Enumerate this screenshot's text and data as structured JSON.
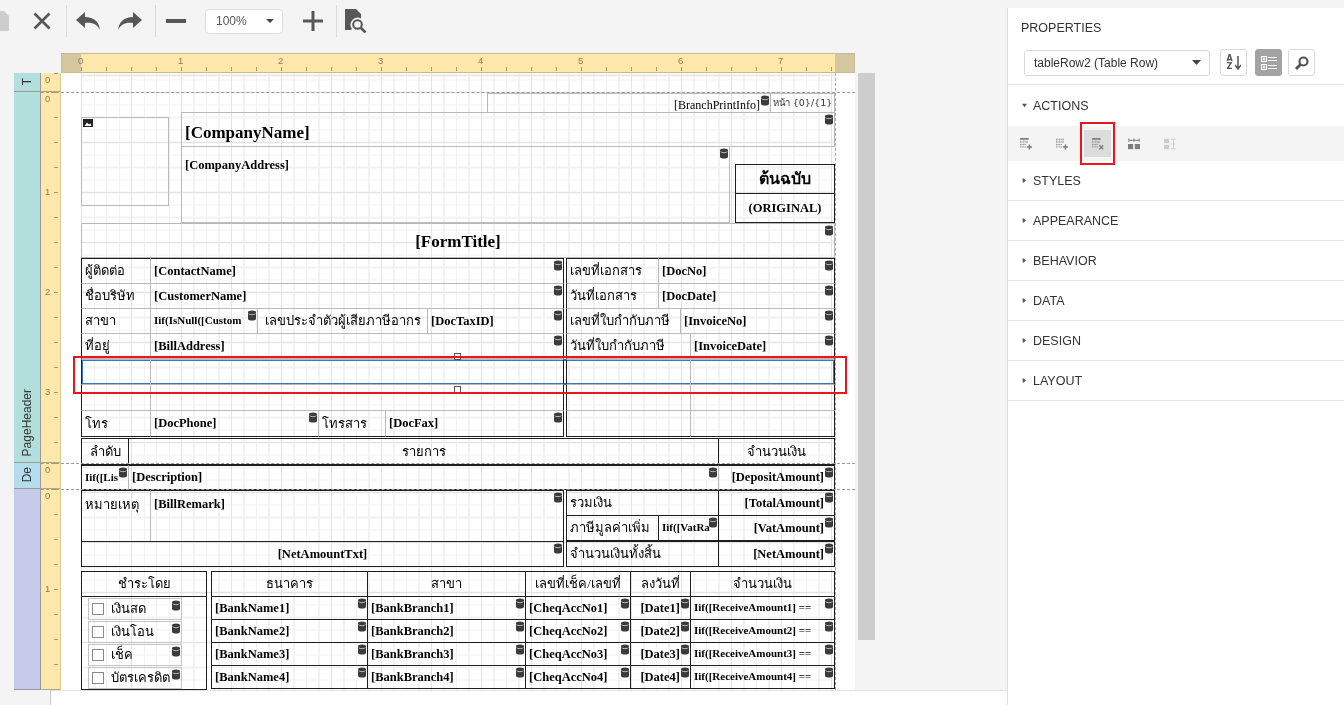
{
  "toolbar": {
    "buttons": [
      {
        "disabled": true
      },
      {
        "disabled": false
      },
      {
        "disabled": false
      },
      {
        "disabled": false
      },
      {
        "disabled": false
      },
      {
        "disabled": false
      },
      {
        "disabled": false
      }
    ],
    "zoom": "100%"
  },
  "design_surface": {
    "ruler": [
      "0",
      "1",
      "2",
      "3",
      "4",
      "5",
      "6",
      "7"
    ],
    "bands": [
      {
        "label": "T",
        "color": "#b2dfdb",
        "ruler": [
          "0"
        ]
      },
      {
        "label": "PageHeader",
        "color": "#b2dfdb",
        "ruler": [
          "0",
          "1",
          "2",
          "3"
        ]
      },
      {
        "label": "De",
        "color": "#b3dcec",
        "ruler": [
          "0"
        ]
      },
      {
        "color": "#c5cae9",
        "ruler": [
          "0",
          "1"
        ]
      }
    ],
    "header": [
      {
        "text": "[BranchPrintInfo]",
        "bound": true
      },
      {
        "text": "หน้า {0}/{1}",
        "bound": false
      },
      {
        "text": "[CompanyName]",
        "bound": true
      },
      {
        "text": "[CompanyAddress]",
        "bound": true
      },
      {
        "text": "ต้นฉบับ",
        "bound": false
      },
      {
        "text": "(ORIGINAL)",
        "bound": false
      },
      {
        "text": "[FormTitle]",
        "bound": true
      }
    ],
    "info_rows": [
      {
        "selected": false,
        "highlighted": false,
        "cells": [
          {
            "text": "ผู้ติดต่อ",
            "kind": "label",
            "bound": false
          },
          {
            "text": "[ContactName]",
            "kind": "field",
            "bound": true
          },
          {
            "text": "เลขที่เอกสาร",
            "kind": "label",
            "bound": false
          },
          {
            "text": "[DocNo]",
            "kind": "field",
            "bound": true
          }
        ]
      },
      {
        "selected": false,
        "highlighted": false,
        "cells": [
          {
            "text": "ชื่อบริษัท",
            "kind": "label",
            "bound": false
          },
          {
            "text": "[CustomerName]",
            "kind": "field",
            "bound": true
          },
          {
            "text": "วันที่เอกสาร",
            "kind": "label",
            "bound": false
          },
          {
            "text": "[DocDate]",
            "kind": "field",
            "bound": true
          }
        ]
      },
      {
        "selected": false,
        "highlighted": false,
        "cells": [
          {
            "text": "สาขา",
            "kind": "label",
            "bound": false
          },
          {
            "text": "Iif(IsNull([Custom",
            "kind": "field",
            "bound": true
          },
          {
            "text": "เลขประจำตัวผู้เสียภาษีอากร",
            "kind": "label",
            "bound": false
          },
          {
            "text": "[DocTaxID]",
            "kind": "field",
            "bound": true
          },
          {
            "text": "เลขที่ใบกำกับภาษี",
            "kind": "label",
            "bound": false
          },
          {
            "text": "[InvoiceNo]",
            "kind": "field",
            "bound": true
          }
        ]
      },
      {
        "selected": false,
        "highlighted": false,
        "cells": [
          {
            "text": "ที่อยู่",
            "kind": "label",
            "bound": false
          },
          {
            "text": "[BillAddress]",
            "kind": "field",
            "bound": true
          },
          {
            "text": "วันที่ใบกำกับภาษี",
            "kind": "label",
            "bound": false
          },
          {
            "text": "[InvoiceDate]",
            "kind": "field",
            "bound": true
          }
        ]
      },
      {
        "selected": true,
        "highlighted": true
      },
      {
        "selected": false,
        "highlighted": false
      },
      {
        "selected": false,
        "highlighted": false,
        "cells": [
          {
            "text": "โทร",
            "kind": "label",
            "bound": false
          },
          {
            "text": "[DocPhone]",
            "kind": "field",
            "bound": true
          },
          {
            "text": "โทรสาร",
            "kind": "label",
            "bound": false
          },
          {
            "text": "[DocFax]",
            "kind": "field",
            "bound": true
          }
        ]
      }
    ],
    "items_table": {
      "header": [
        {
          "text": "ลำดับ",
          "kind": "label",
          "bound": false
        },
        {
          "text": "รายการ",
          "kind": "label",
          "bound": false
        },
        {
          "text": "จำนวนเงิน",
          "kind": "label",
          "bound": false
        }
      ],
      "detail": [
        {
          "text": "Iif([Lis",
          "kind": "field",
          "bound": true
        },
        {
          "text": "[Description]",
          "kind": "field",
          "bound": true
        },
        {
          "text": "[DepositAmount]",
          "kind": "field",
          "bound": true
        }
      ]
    },
    "totals": [
      {
        "text": "หมายเหตุ",
        "kind": "label",
        "bound": false
      },
      {
        "text": "[BillRemark]",
        "kind": "field",
        "bound": true
      },
      {
        "text": "รวมเงิน",
        "kind": "label",
        "bound": false
      },
      {
        "text": "[TotalAmount]",
        "kind": "field",
        "bound": true
      },
      {
        "text": "ภาษีมูลค่าเพิ่ม",
        "kind": "label",
        "bound": false
      },
      {
        "text": "Iif([VatRa",
        "kind": "field",
        "bound": true
      },
      {
        "text": "[VatAmount]",
        "kind": "field",
        "bound": true
      },
      {
        "text": "[NetAmountTxt]",
        "kind": "field",
        "bound": true
      },
      {
        "text": "จำนวนเงินทั้งสิ้น",
        "kind": "label",
        "bound": false
      },
      {
        "text": "[NetAmount]",
        "kind": "field",
        "bound": true
      }
    ],
    "payment": {
      "title": {
        "text": "ชำระโดย",
        "kind": "label",
        "bound": false
      },
      "methods": [
        {
          "text": "เงินสด",
          "checked": false,
          "bound": true
        },
        {
          "text": "เงินโอน",
          "checked": false,
          "bound": true
        },
        {
          "text": "เช็ค",
          "checked": false,
          "bound": true
        },
        {
          "text": "บัตรเครดิต",
          "checked": false,
          "bound": true
        }
      ],
      "columns": [
        {
          "text": "ธนาคาร",
          "kind": "label",
          "bound": false
        },
        {
          "text": "สาขา",
          "kind": "label",
          "bound": false
        },
        {
          "text": "เลขที่เช็ค/เลขที่",
          "kind": "label",
          "bound": false
        },
        {
          "text": "ลงวันที่",
          "kind": "label",
          "bound": false
        },
        {
          "text": "จำนวนเงิน",
          "kind": "label",
          "bound": false
        }
      ],
      "rows": [
        {
          "cells": [
            {
              "text": "[BankName1]",
              "kind": "field",
              "bound": true
            },
            {
              "text": "[BankBranch1]",
              "kind": "field",
              "bound": true
            },
            {
              "text": "[CheqAccNo1]",
              "kind": "field",
              "bound": true
            },
            {
              "text": "[Date1]",
              "kind": "field",
              "bound": true
            },
            {
              "text": "Iif([ReceiveAmount1] ==",
              "kind": "field",
              "bound": true
            }
          ]
        },
        {
          "cells": [
            {
              "text": "[BankName2]",
              "kind": "field",
              "bound": true
            },
            {
              "text": "[BankBranch2]",
              "kind": "field",
              "bound": true
            },
            {
              "text": "[CheqAccNo2]",
              "kind": "field",
              "bound": true
            },
            {
              "text": "[Date2]",
              "kind": "field",
              "bound": true
            },
            {
              "text": "Iif([ReceiveAmount2] ==",
              "kind": "field",
              "bound": true
            }
          ]
        },
        {
          "cells": [
            {
              "text": "[BankName3]",
              "kind": "field",
              "bound": true
            },
            {
              "text": "[BankBranch3]",
              "kind": "field",
              "bound": true
            },
            {
              "text": "[CheqAccNo3]",
              "kind": "field",
              "bound": true
            },
            {
              "text": "[Date3]",
              "kind": "field",
              "bound": true
            },
            {
              "text": "Iif([ReceiveAmount3] ==",
              "kind": "field",
              "bound": true
            }
          ]
        },
        {
          "cells": [
            {
              "text": "[BankName4]",
              "kind": "field",
              "bound": true
            },
            {
              "text": "[BankBranch4]",
              "kind": "field",
              "bound": true
            },
            {
              "text": "[CheqAccNo4]",
              "kind": "field",
              "bound": true
            },
            {
              "text": "[Date4]",
              "kind": "field",
              "bound": true
            },
            {
              "text": "Iif([ReceiveAmount4] ==",
              "kind": "field",
              "bound": true
            }
          ]
        }
      ]
    }
  },
  "properties": {
    "title": "PROPERTIES",
    "object": "tableRow2 (Table Row)",
    "sort_button": {
      "letters": [
        "A",
        "Z"
      ],
      "selected": false
    },
    "categories_button": {
      "selected": true
    },
    "sections": [
      {
        "label": "ACTIONS",
        "expanded": true,
        "actions": [
          {
            "hovered": false,
            "highlighted": false,
            "disabled": false
          },
          {
            "hovered": false,
            "highlighted": false,
            "disabled": false
          },
          {
            "hovered": true,
            "highlighted": true,
            "disabled": false
          },
          {
            "hovered": false,
            "highlighted": false,
            "disabled": false
          },
          {
            "hovered": false,
            "highlighted": false,
            "disabled": true
          }
        ]
      },
      {
        "label": "STYLES",
        "expanded": false
      },
      {
        "label": "APPEARANCE",
        "expanded": false
      },
      {
        "label": "BEHAVIOR",
        "expanded": false
      },
      {
        "label": "DATA",
        "expanded": false
      },
      {
        "label": "DESIGN",
        "expanded": false
      },
      {
        "label": "LAYOUT",
        "expanded": false
      }
    ]
  }
}
